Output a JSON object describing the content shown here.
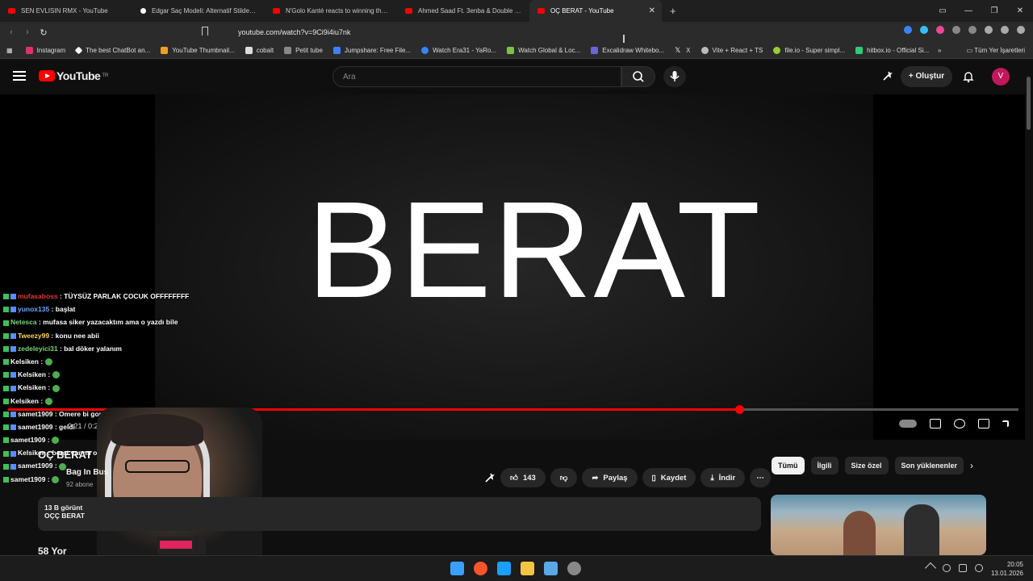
{
  "browser": {
    "tabs": [
      {
        "title": "SEN EVLISIN RMX - YouTube",
        "icon": "youtube-icon"
      },
      {
        "title": "Edgar Saç Modeli: Alternatif Stilde Sa",
        "icon": "tiktok-icon"
      },
      {
        "title": "N'Golo Kanté reacts to winning the L",
        "icon": "youtube-icon"
      },
      {
        "title": "Ahmed Saad Ft. 3enba & Double Zuk",
        "icon": "youtube-icon"
      },
      {
        "title": "OÇ BERAT - YouTube",
        "icon": "youtube-icon",
        "active": true
      }
    ],
    "new_tab": "+",
    "url": "youtube.com/watch?v=9Ci9i4iu7nk",
    "bookmarks": [
      {
        "label": "Instagram",
        "color": "#e1306c"
      },
      {
        "label": "The best ChatBot an...",
        "color": "#ffffff"
      },
      {
        "label": "YouTube Thumbnail...",
        "color": "#f0a020"
      },
      {
        "label": "cobalt",
        "color": "#dddddd"
      },
      {
        "label": "Petit tube",
        "color": "#888888"
      },
      {
        "label": "Jumpshare: Free File...",
        "color": "#3b82f6"
      },
      {
        "label": "Watch Era31 - YaRo...",
        "color": "#3b82f6"
      },
      {
        "label": "Watch Global & Loc...",
        "color": "#7cc242"
      },
      {
        "label": "Excalidraw Whitebo...",
        "color": "#6965db"
      },
      {
        "label": "X",
        "color": "#ffffff"
      },
      {
        "label": "Vite + React + TS",
        "color": "#bbbbbb"
      },
      {
        "label": "file.io - Super simpl...",
        "color": "#9acd32"
      },
      {
        "label": "hitbox.io - Official Si...",
        "color": "#2ecc71"
      }
    ],
    "all_bookmarks": "Tüm Yer İşaretleri",
    "more": "»"
  },
  "youtube": {
    "logo": "YouTube",
    "region": "TR",
    "search_placeholder": "Ara",
    "create_label": "+ Oluştur",
    "avatar_letter": "V",
    "brand_color": "#ff0000"
  },
  "player": {
    "frame_text": "BERAT",
    "time": "0:21 / 0:29",
    "progress": 0.724
  },
  "chat": [
    {
      "user": "mufasaboss",
      "user_color": "#e53935",
      "msg": "TÜYSÜZ PARLAK ÇOCUK OFFFFFFFF"
    },
    {
      "user": "yunox135",
      "user_color": "#6aa7ff",
      "msg": "başlat"
    },
    {
      "user": "Netesca",
      "user_color": "#7cd67c",
      "msg": "mufasa siker yazacaktım ama o yazdı bile"
    },
    {
      "user": "Tweezy99",
      "user_color": "#ffd54f",
      "msg": "konu nee abii"
    },
    {
      "user": "zedeleyici31",
      "user_color": "#7cd67c",
      "msg": "bal döker yalanım"
    },
    {
      "user": "Kelsiken",
      "user_color": "#ffffff",
      "msg": ""
    },
    {
      "user": "Kelsiken",
      "user_color": "#ffffff",
      "msg": ""
    },
    {
      "user": "Kelsiken",
      "user_color": "#ffffff",
      "msg": ""
    },
    {
      "user": "Kelsiken",
      "user_color": "#ffffff",
      "msg": ""
    },
    {
      "user": "samet1909",
      "user_color": "#ffffff",
      "msg": "Omere bi gondermem"
    },
    {
      "user": "samet1909",
      "user_color": "#ffffff",
      "msg": "geldi"
    },
    {
      "user": "samet1909",
      "user_color": "#ffffff",
      "msg": ""
    },
    {
      "user": "Kelsiken",
      "user_color": "#ffffff",
      "msg": "berat var mı o"
    },
    {
      "user": "samet1909",
      "user_color": "#ffffff",
      "msg": ""
    },
    {
      "user": "samet1909",
      "user_color": "#ffffff",
      "msg": ""
    }
  ],
  "video": {
    "title": "OÇ BERAT",
    "channel": "Bag In Bus",
    "subs": "92 abone",
    "likes": "143",
    "share": "Paylaş",
    "save": "Kaydet",
    "download": "İndir",
    "more": "⋯",
    "views": "13 B görünt",
    "desc_line": "OÇÇ BERAT",
    "comments": "58 Yor"
  },
  "chips": [
    "Tümü",
    "İlgili",
    "Size özel",
    "Son yüklenenler"
  ],
  "taskbar": {
    "time": "20:05",
    "date": "13.01.2026"
  }
}
